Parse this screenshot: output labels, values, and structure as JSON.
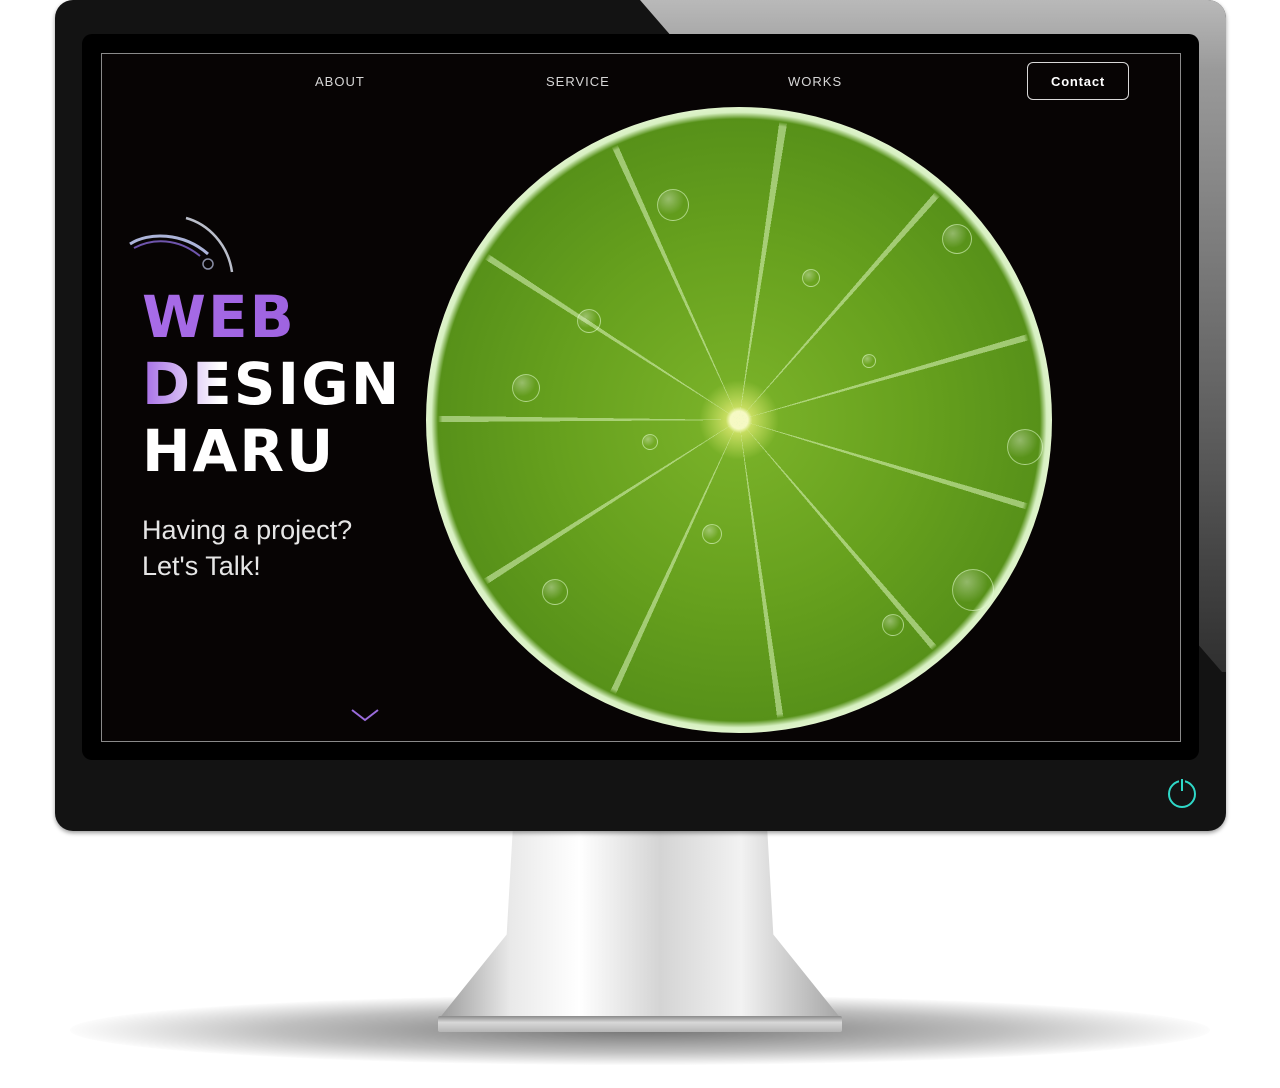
{
  "nav": {
    "items": [
      {
        "label": "ABOUT"
      },
      {
        "label": "SERVICE"
      },
      {
        "label": "WORKS"
      }
    ],
    "contact_label": "Contact"
  },
  "hero": {
    "title_line1": "WEB",
    "title_line2": "DESIGN",
    "title_line3": "HARU",
    "tagline_line1": "Having a project?",
    "tagline_line2": "Let's Talk!"
  },
  "icons": {
    "scroll": "chevron-down-icon",
    "power": "power-icon"
  },
  "colors": {
    "accent_purple": "#a86ce8",
    "power_led": "#2fd8c8",
    "screen_bg": "#070404"
  }
}
